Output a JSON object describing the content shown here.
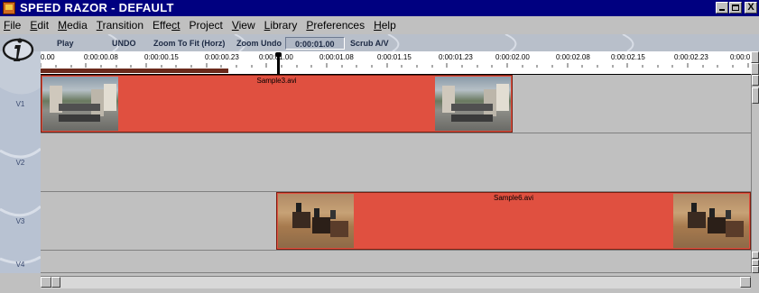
{
  "window": {
    "title": "SPEED RAZOR - DEFAULT",
    "close_glyph": "X"
  },
  "menu": [
    {
      "first": "F",
      "rest": "ile"
    },
    {
      "first": "E",
      "rest": "dit"
    },
    {
      "first": "M",
      "rest": "edia"
    },
    {
      "first": "T",
      "rest": "ransition"
    },
    {
      "first": "Effe",
      "rest": "ct"
    },
    {
      "first": "Pr",
      "rest": "oject"
    },
    {
      "first": "V",
      "rest": "iew"
    },
    {
      "first": "L",
      "rest": "ibrary"
    },
    {
      "first": "P",
      "rest": "references"
    },
    {
      "first": "H",
      "rest": "elp"
    }
  ],
  "toolbar": {
    "play": "Play",
    "undo": "UNDO",
    "zoom_fit": "Zoom To Fit (Horz)",
    "zoom_undo": "Zoom Undo",
    "timecode": "0:00:01.00",
    "scrub": "Scrub A/V"
  },
  "logo_icon": "info-i-logo-icon",
  "ruler": {
    "labels": [
      "0.00",
      "0:00:00.08",
      "0:00:00.15",
      "0:00:00.23",
      "0:00:01.00",
      "0:00:01.08",
      "0:00:01.15",
      "0:00:01.23",
      "0:00:02.00",
      "0:00:02.08",
      "0:00:02.15",
      "0:00:02.23",
      "0:00:0"
    ]
  },
  "tracks": [
    {
      "label": "V1"
    },
    {
      "label": "V2"
    },
    {
      "label": "V3"
    },
    {
      "label": "V4"
    }
  ],
  "clips": {
    "v1": {
      "name": "Sample3.avi"
    },
    "v3": {
      "name": "Sample6.avi"
    }
  },
  "colors": {
    "clip": "#e05040",
    "titlebar": "#000080",
    "track_bg": "#c0c0c0"
  }
}
